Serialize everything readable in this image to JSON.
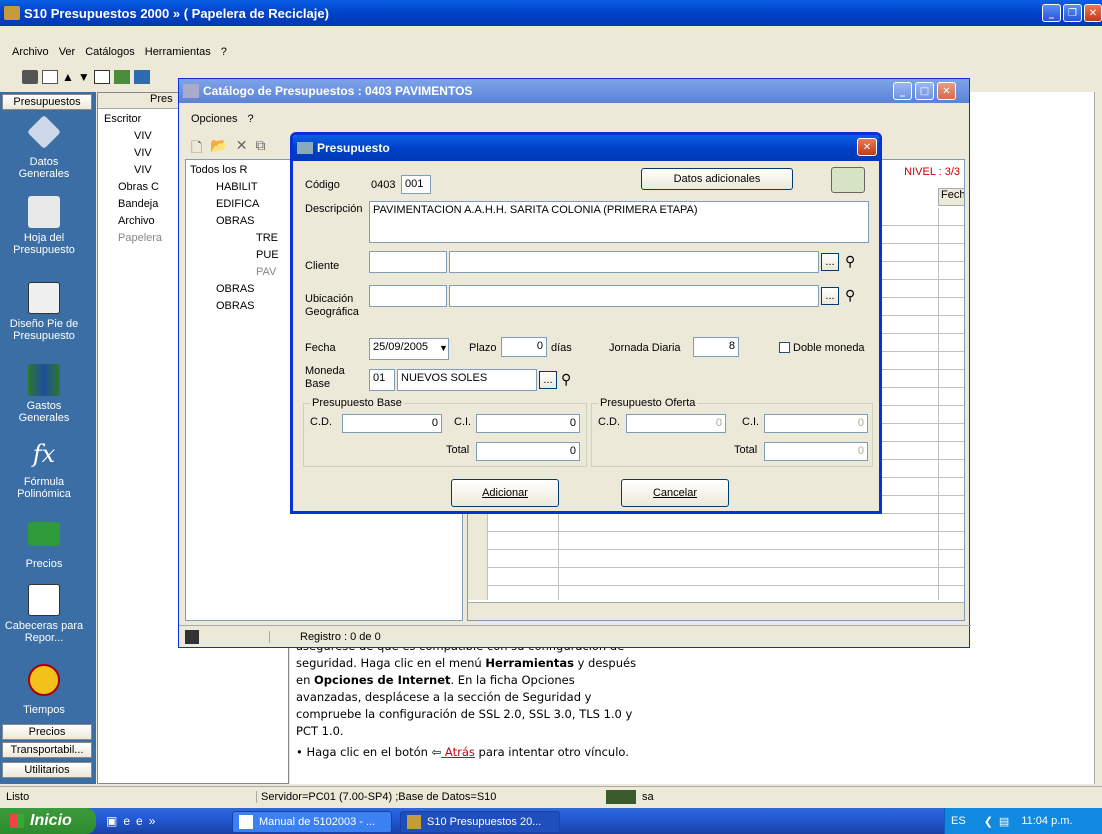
{
  "main_window": {
    "title": "S10 Presupuestos 2000 » ( Papelera de Reciclaje)"
  },
  "menu": [
    "Archivo",
    "Ver",
    "Catálogos",
    "Herramientas",
    "?"
  ],
  "sidebar": {
    "tab_top": "Presupuestos",
    "items": [
      {
        "label": "Datos Generales",
        "icon": "datos-generales-icon"
      },
      {
        "label": "Hoja del Presupuesto",
        "icon": "hoja-presupuesto-icon"
      },
      {
        "label": "Diseño Pie de Presupuesto",
        "icon": "diseno-pie-icon"
      },
      {
        "label": "Gastos Generales",
        "icon": "gastos-generales-icon"
      },
      {
        "label": "Fórmula Polinómica",
        "icon": "formula-icon"
      },
      {
        "label": "Precios",
        "icon": "precios-icon"
      },
      {
        "label": "Cabeceras para Repor...",
        "icon": "cabeceras-icon"
      },
      {
        "label": "Tiempos",
        "icon": "tiempos-icon"
      }
    ],
    "tabs_bottom": [
      "Precios",
      "Transportabil...",
      "Utilitarios"
    ]
  },
  "tree_panel": {
    "header": "Pres",
    "items": [
      "Escritor",
      "VIV",
      "VIV",
      "VIV",
      "Obras C",
      "Bandeja",
      "Archivo",
      "Papelera"
    ]
  },
  "catalog": {
    "title": "Catálogo de Presupuestos  : 0403  PAVIMENTOS",
    "menu": [
      "Opciones",
      "?"
    ],
    "tree": [
      "Todos los R",
      "HABILIT",
      "EDIFICA",
      "OBRAS",
      "TRE",
      "PUE",
      "PAV",
      "OBRAS",
      "OBRAS"
    ],
    "nivel": "NIVEL : 3/3",
    "col_header": "Fech",
    "status": "Registro : 0 de 0"
  },
  "dialog": {
    "title": "Presupuesto",
    "codigo_label": "Código",
    "codigo_prefix": "0403",
    "codigo_value": "001",
    "datos_btn": "Datos adicionales",
    "descripcion_label": "Descripción",
    "descripcion_value": "PAVIMENTACION A.A.H.H. SARITA COLONIA (PRIMERA ETAPA)",
    "cliente_label": "Cliente",
    "ubicacion_label": "Ubicación Geográfica",
    "fecha_label": "Fecha",
    "fecha_value": "25/09/2005",
    "plazo_label": "Plazo",
    "plazo_value": "0",
    "dias": "días",
    "jornada_label": "Jornada Diaria",
    "jornada_value": "8",
    "doble_label": "Doble moneda",
    "moneda_label": "Moneda Base",
    "moneda_code": "01",
    "moneda_name": "NUEVOS SOLES",
    "base_group": "Presupuesto Base",
    "oferta_group": "Presupuesto Oferta",
    "cd": "C.D.",
    "ci": "C.I.",
    "total": "Total",
    "base_cd": "0",
    "base_ci": "0",
    "base_total": "0",
    "of_cd": "0",
    "of_ci": "0",
    "of_total": "0",
    "adicionar": "Adicionar",
    "cancelar": "Cancelar"
  },
  "browser_text": {
    "line1": "asegúrese de que es compatible con su configuración de",
    "line2a": "seguridad. Haga clic en el menú ",
    "line2b": "Herramientas",
    "line2c": " y después",
    "line3a": "en ",
    "line3b": "Opciones de Internet",
    "line3c": ". En la ficha Opciones",
    "line4": "avanzadas, desplácese a la sección de Seguridad y",
    "line5": "compruebe la configuración de SSL 2.0, SSL 3.0, TLS 1.0 y",
    "line6": "PCT 1.0.",
    "bullet_a": "Haga clic en el botón ",
    "bullet_link": " Atrás",
    "bullet_b": " para intentar otro vínculo."
  },
  "statusbar": {
    "left": "Listo",
    "server": "Servidor=PC01 (7.00-SP4) ;Base de Datos=S10",
    "user": "sa"
  },
  "taskbar": {
    "start": "Inicio",
    "tasks": [
      "Manual de 5102003 - ...",
      "S10 Presupuestos 20..."
    ],
    "lang": "ES",
    "time": "11:04 p.m."
  }
}
